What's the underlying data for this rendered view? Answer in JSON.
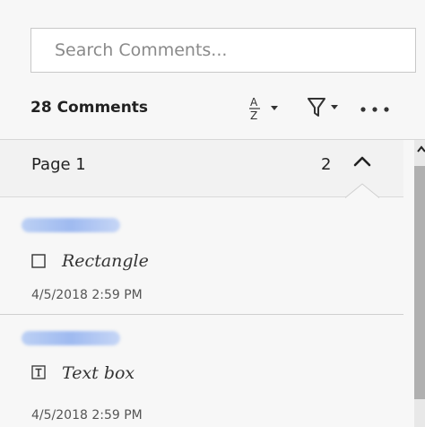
{
  "search": {
    "placeholder": "Search Comments..."
  },
  "toolbar": {
    "count_label": "28 Comments",
    "sort_icon": "sort-az-icon",
    "filter_icon": "filter-icon",
    "more_icon": "more-options-icon"
  },
  "page_group": {
    "label": "Page 1",
    "count": "2",
    "collapse_icon": "chevron-up-icon"
  },
  "comments": [
    {
      "author": "",
      "type_icon": "rectangle-icon",
      "type": "Rectangle",
      "date": "4/5/2018  2:59 PM"
    },
    {
      "author": "",
      "type_icon": "text-box-icon",
      "type": "Text box",
      "date": "4/5/2018  2:59 PM"
    }
  ],
  "colors": {
    "background": "#f7f7f7",
    "accent_text": "#222222",
    "scroll_thumb": "#b0b0b0",
    "redaction_blue": "#9fbaf0"
  }
}
